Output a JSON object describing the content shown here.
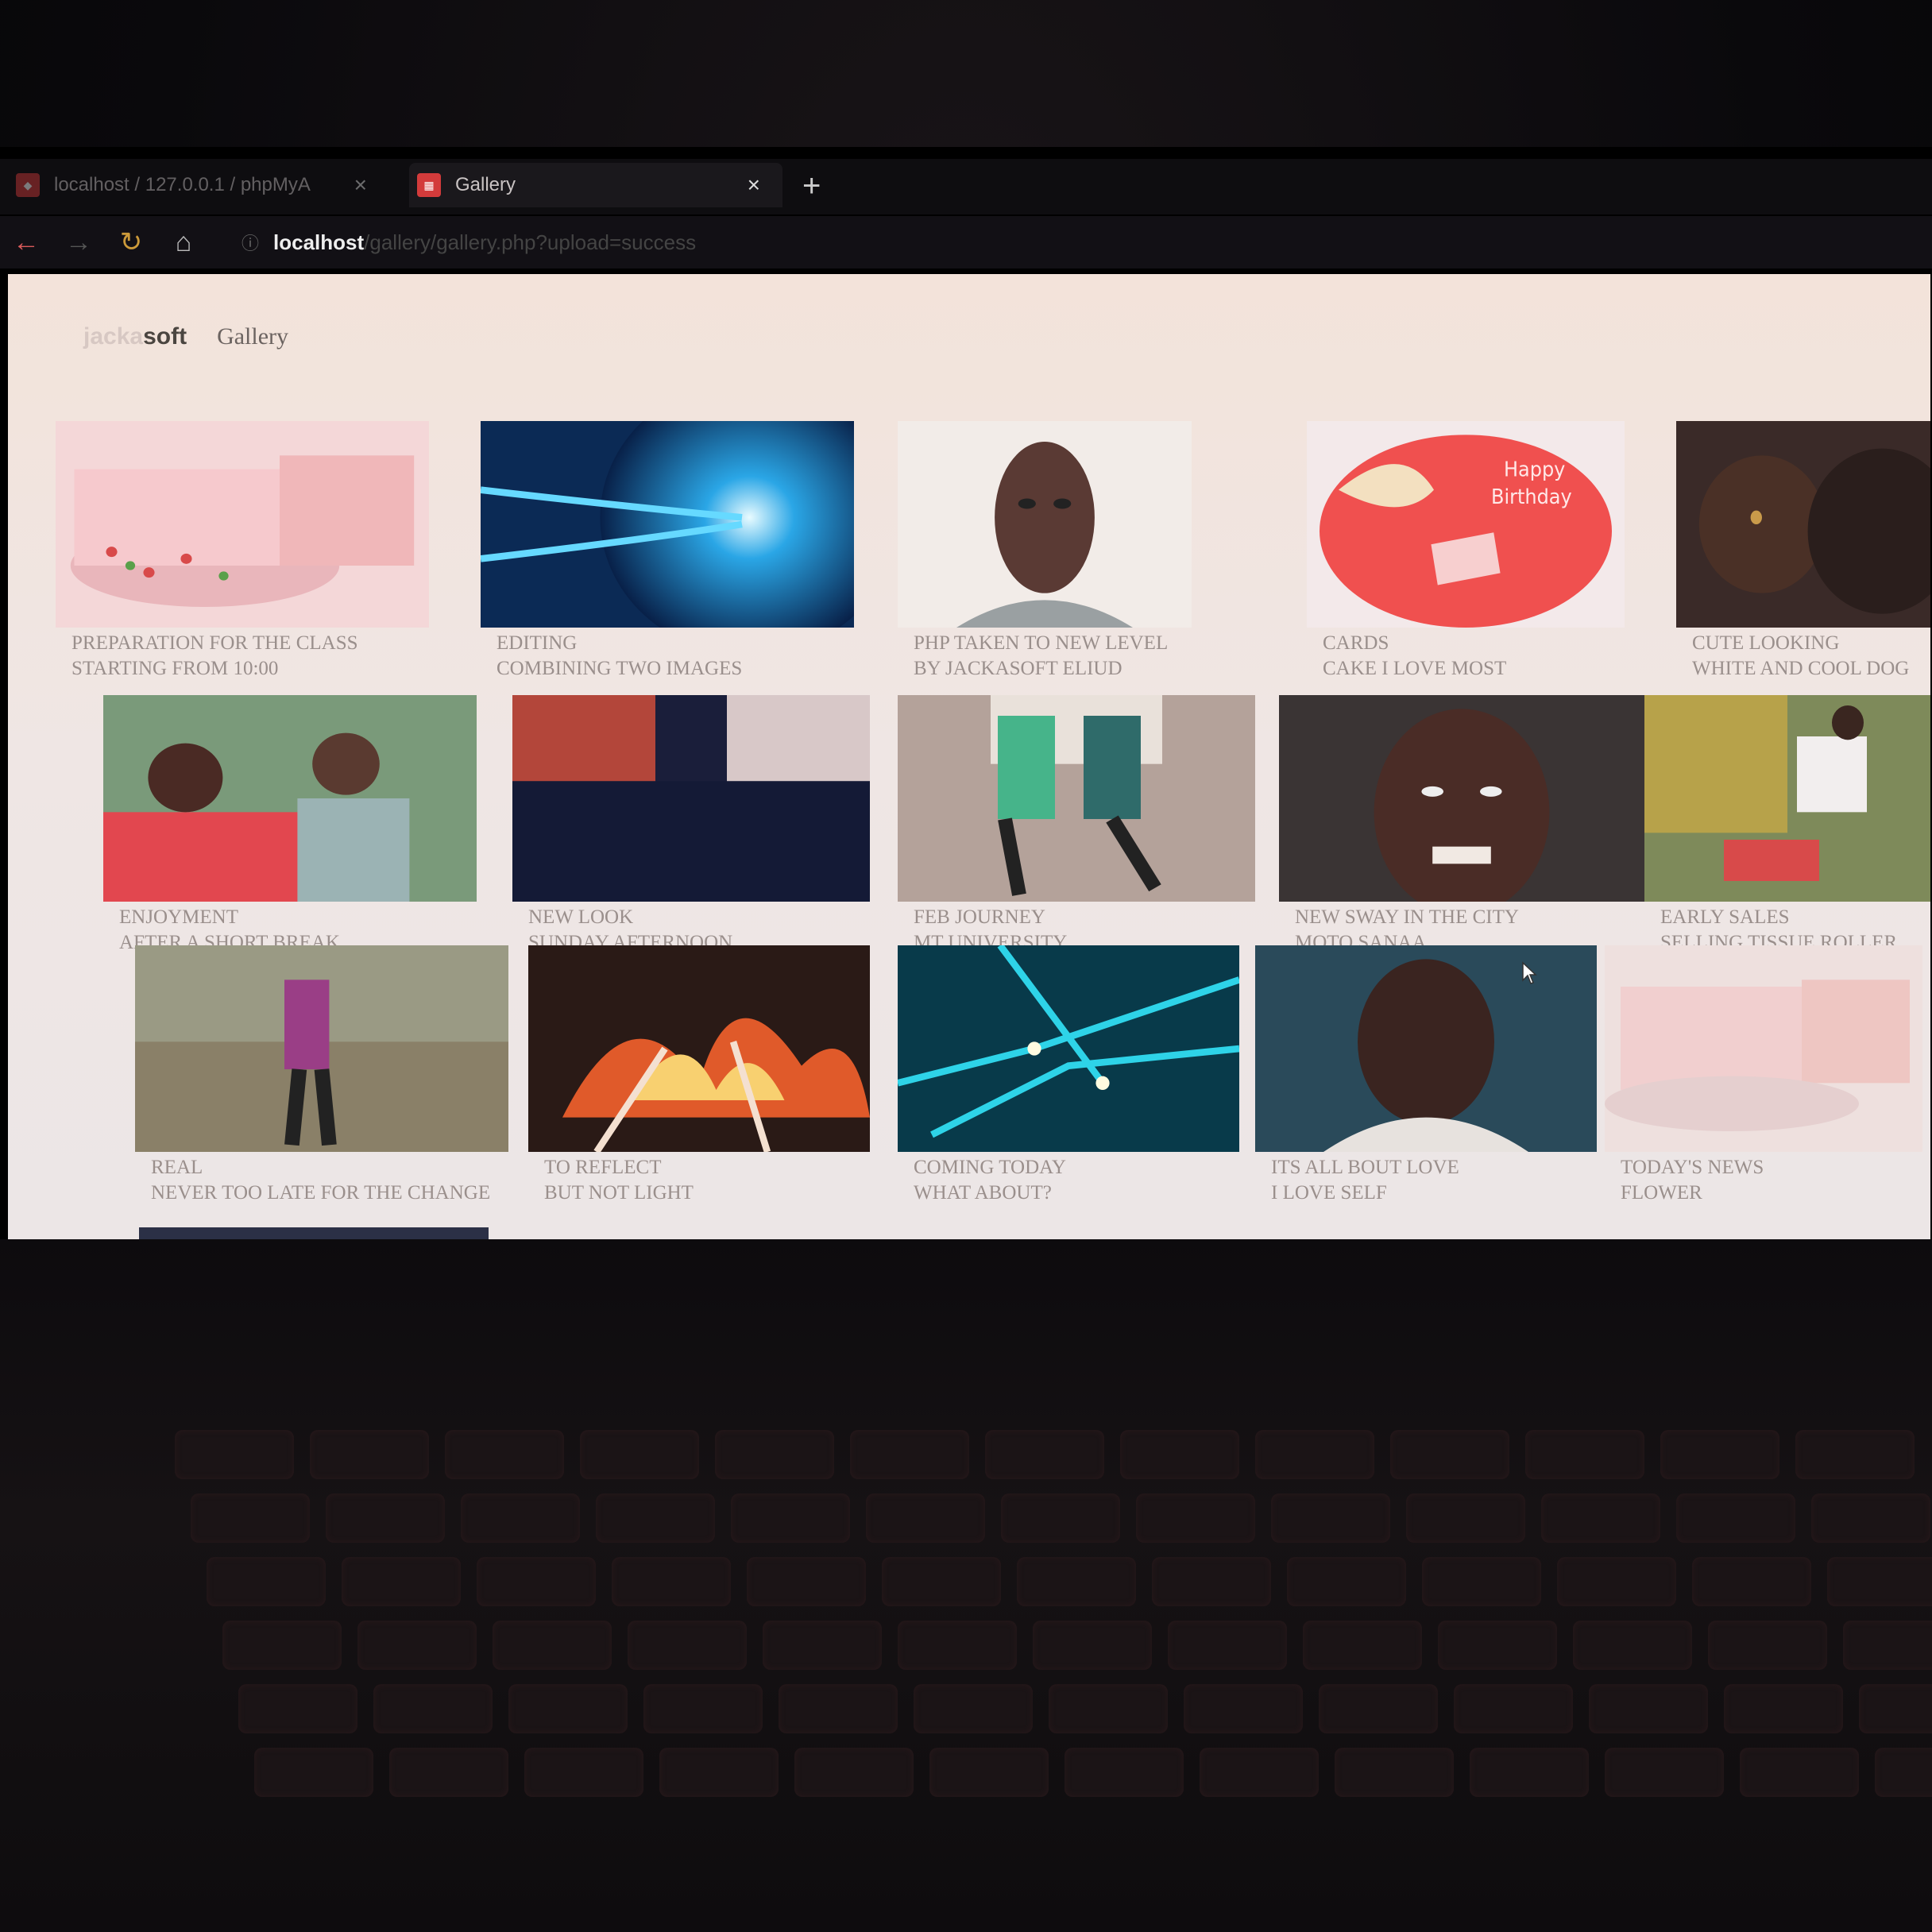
{
  "browser": {
    "tabs": [
      {
        "label": "localhost / 127.0.0.1 / phpMyA",
        "active": false
      },
      {
        "label": "Gallery",
        "active": true
      }
    ],
    "url": {
      "host": "localhost",
      "path": "/gallery/gallery.php?upload=success"
    }
  },
  "site": {
    "brand_faded": "jacka",
    "brand": "soft",
    "nav_link": "Gallery"
  },
  "gallery": [
    {
      "title": "PREPARATION FOR THE CLASS",
      "desc": "STARTING FROM 10:00"
    },
    {
      "title": "EDITING",
      "desc": "COMBINING TWO IMAGES"
    },
    {
      "title": "PHP TAKEN TO NEW LEVEL",
      "desc": "BY JACKASOFT ELIUD"
    },
    {
      "title": "CARDS",
      "desc": "CAKE I LOVE MOST"
    },
    {
      "title": "CUTE LOOKING",
      "desc": "WHITE AND COOL DOG"
    },
    {
      "title": "ENJOYMENT",
      "desc": "AFTER A SHORT BREAK"
    },
    {
      "title": "NEW LOOK",
      "desc": "SUNDAY AFTERNOON"
    },
    {
      "title": "FEB JOURNEY",
      "desc": "MT UNIVERSITY"
    },
    {
      "title": "NEW SWAY IN THE CITY",
      "desc": "MOTO SANAA"
    },
    {
      "title": "EARLY SALES",
      "desc": "SELLING TISSUE ROLLER"
    },
    {
      "title": "REAL",
      "desc": "NEVER TOO LATE FOR THE CHANGE"
    },
    {
      "title": "TO REFLECT",
      "desc": "BUT NOT LIGHT"
    },
    {
      "title": "COMING TODAY",
      "desc": "WHAT ABOUT?"
    },
    {
      "title": "ITS ALL BOUT LOVE",
      "desc": "I LOVE SELF"
    },
    {
      "title": "TODAY'S NEWS",
      "desc": "FLOWER"
    }
  ],
  "cake_text": "Happy Birthday",
  "icons": [
    "back-arrow-icon",
    "forward-arrow-icon",
    "reload-icon",
    "home-icon",
    "info-icon",
    "close-icon",
    "plus-icon",
    "mouse-cursor-icon"
  ]
}
